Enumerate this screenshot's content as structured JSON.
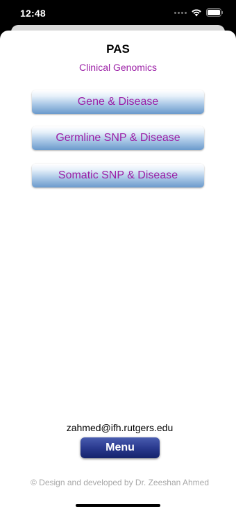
{
  "status": {
    "time": "12:48"
  },
  "header": {
    "title": "PAS",
    "subtitle": "Clinical Genomics"
  },
  "menu": {
    "items": [
      {
        "label": "Gene & Disease"
      },
      {
        "label": "Germline SNP & Disease"
      },
      {
        "label": "Somatic SNP & Disease"
      }
    ]
  },
  "footer": {
    "email": "zahmed@ifh.rutgers.edu",
    "menu_label": "Menu",
    "copyright": "© Design and developed by Dr. Zeeshan Ahmed"
  },
  "colors": {
    "accent_text": "#9b1fa6",
    "button_blue": "#6b9acc",
    "menu_button": "#2a3a8f"
  },
  "icons": [
    "signal-dots-icon",
    "wifi-icon",
    "battery-icon"
  ]
}
